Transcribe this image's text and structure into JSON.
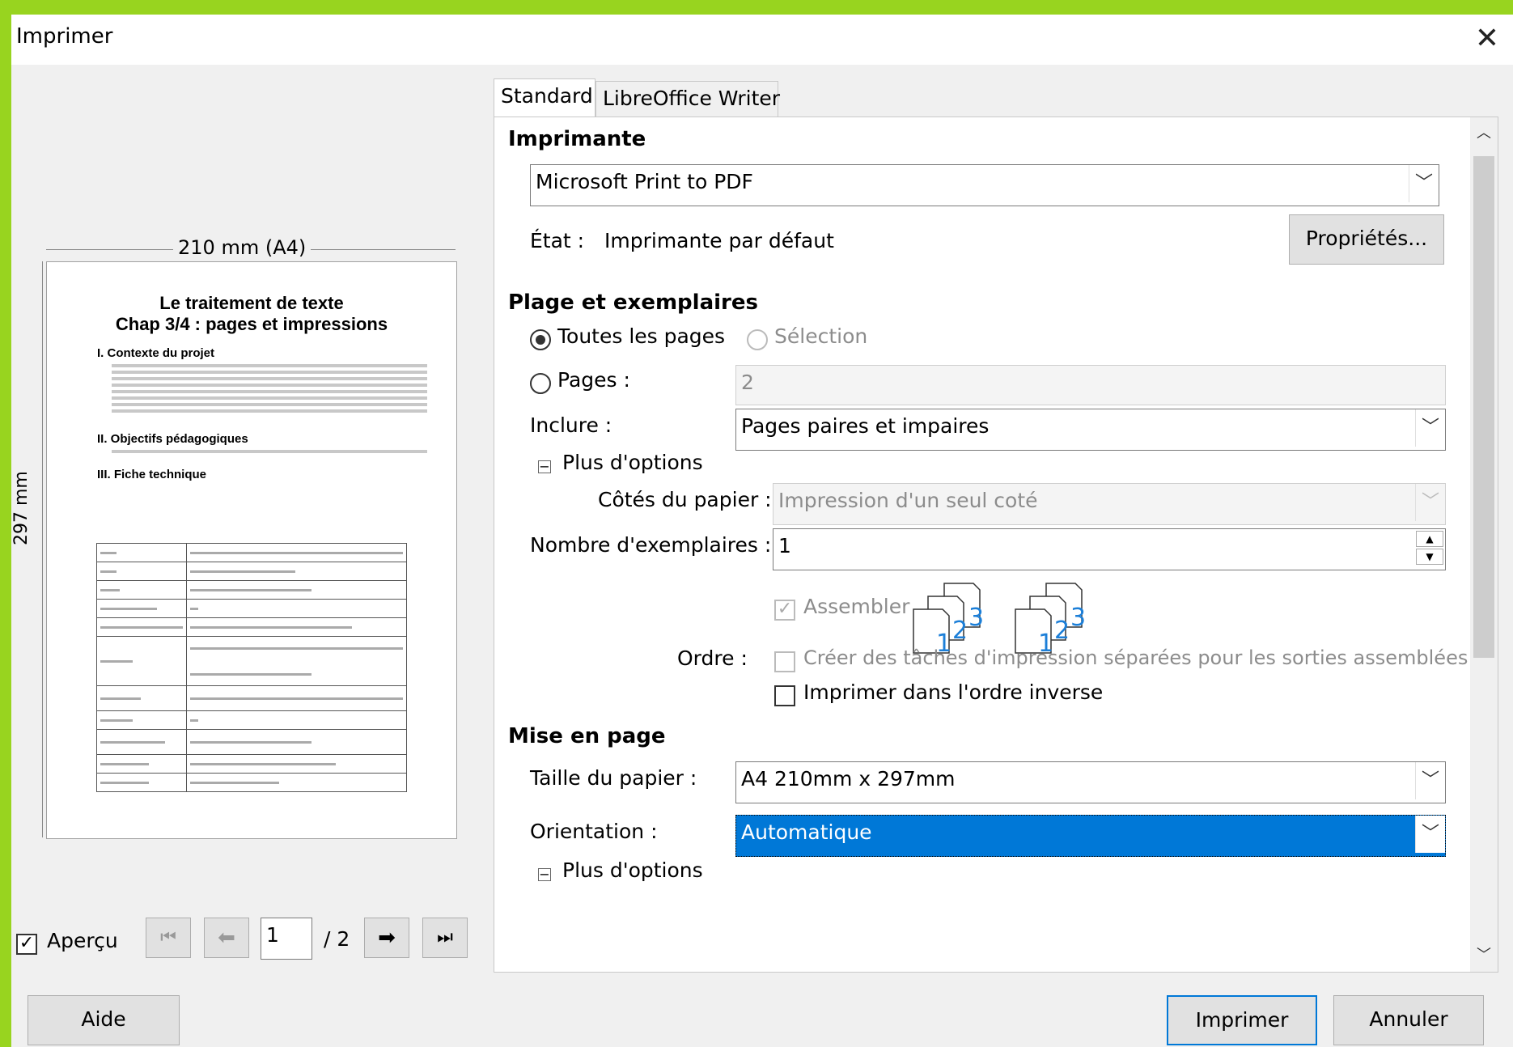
{
  "window": {
    "title": "Imprimer",
    "close_label": "✕"
  },
  "preview": {
    "width_label": "210 mm (A4)",
    "height_label": "297 mm",
    "doc_title_line1": "Le traitement de texte",
    "doc_title_line2": "Chap 3/4 : pages et impressions",
    "doc_h1": "I. Contexte du projet",
    "doc_h2": "II. Objectifs pédagogiques",
    "doc_h3": "III. Fiche technique",
    "apercu_label": "Aperçu",
    "page_value": "1",
    "page_total": "/ 2"
  },
  "tabs": [
    {
      "label": "Standard"
    },
    {
      "label": "LibreOffice Writer"
    }
  ],
  "printer": {
    "section": "Imprimante",
    "selected": "Microsoft Print to PDF",
    "etat_label": "État :",
    "etat_value": "Imprimante par défaut",
    "properties_label": "Propriétés..."
  },
  "range": {
    "section": "Plage et exemplaires",
    "all_pages": "Toutes les pages",
    "selection": "Sélection",
    "pages_label": "Pages :",
    "pages_value": "2",
    "include_label": "Inclure :",
    "include_value": "Pages paires et impaires",
    "more_options": "Plus d'options",
    "sides_label": "Côtés du papier :",
    "sides_value": "Impression d'un seul coté",
    "copies_label": "Nombre d'exemplaires :",
    "copies_value": "1",
    "collate_label": "Assembler",
    "order_label": "Ordre :",
    "separate_jobs": "Créer des tâches d'impression séparées pour les sorties assemblées",
    "reverse_order": "Imprimer dans l'ordre inverse"
  },
  "layout": {
    "section": "Mise en page",
    "paper_size_label": "Taille du papier :",
    "paper_size_value": "A4 210mm x 297mm",
    "orientation_label": "Orientation :",
    "orientation_value": "Automatique",
    "more_options": "Plus d'options"
  },
  "buttons": {
    "help": "Aide",
    "print": "Imprimer",
    "cancel": "Annuler"
  },
  "colors": {
    "accent": "#0078d7",
    "frame": "#98d41f"
  }
}
